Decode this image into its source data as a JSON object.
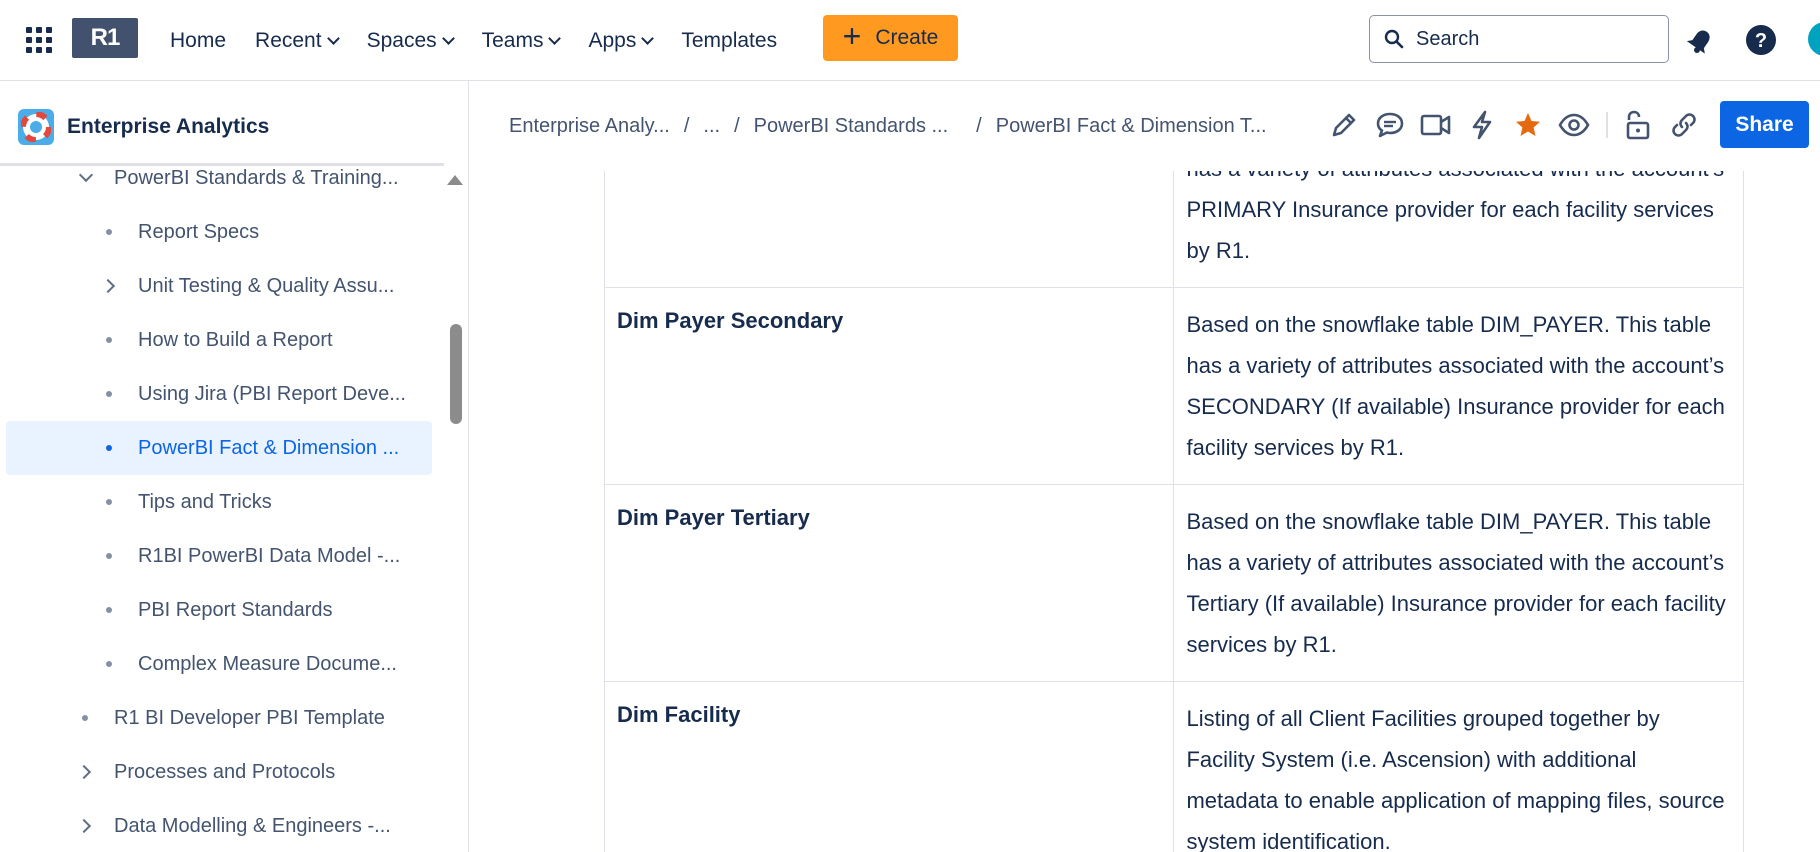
{
  "topbar": {
    "logo_text": "R1",
    "nav": [
      {
        "label": "Home",
        "dropdown": false
      },
      {
        "label": "Recent",
        "dropdown": true
      },
      {
        "label": "Spaces",
        "dropdown": true
      },
      {
        "label": "Teams",
        "dropdown": true
      },
      {
        "label": "Apps",
        "dropdown": true
      },
      {
        "label": "Templates",
        "dropdown": false
      }
    ],
    "create_label": "Create",
    "search_placeholder": "Search",
    "icons": [
      "apps-grid-icon",
      "notifications-icon",
      "help-icon",
      "avatar"
    ]
  },
  "sidebar": {
    "space_title": "Enterprise Analytics",
    "items": [
      {
        "label": "PowerBI Standards & Training...",
        "marker": "chevron-down",
        "level": 0
      },
      {
        "label": "Report Specs",
        "marker": "dot",
        "level": 1
      },
      {
        "label": "Unit Testing & Quality Assu...",
        "marker": "chevron-right",
        "level": 1
      },
      {
        "label": "How to Build a Report",
        "marker": "dot",
        "level": 1
      },
      {
        "label": "Using Jira (PBI Report Deve...",
        "marker": "dot",
        "level": 1
      },
      {
        "label": "PowerBI Fact & Dimension ...",
        "marker": "dot",
        "level": 1,
        "selected": true
      },
      {
        "label": "Tips and Tricks",
        "marker": "dot",
        "level": 1
      },
      {
        "label": "R1BI PowerBI Data Model -...",
        "marker": "dot",
        "level": 1
      },
      {
        "label": "PBI Report Standards",
        "marker": "dot",
        "level": 1
      },
      {
        "label": "Complex Measure Docume...",
        "marker": "dot",
        "level": 1
      },
      {
        "label": "R1 BI Developer PBI Template",
        "marker": "dot",
        "level": 0
      },
      {
        "label": "Processes and Protocols",
        "marker": "chevron-right",
        "level": 0
      },
      {
        "label": "Data Modelling & Engineers -...",
        "marker": "chevron-right",
        "level": 0
      }
    ]
  },
  "page_header": {
    "breadcrumbs": [
      "Enterprise Analy...",
      "...",
      "PowerBI Standards ...",
      "PowerBI Fact & Dimension T..."
    ],
    "separator": "/",
    "action_icons": [
      "edit-icon",
      "comment-icon",
      "video-icon",
      "automation-icon",
      "star-icon",
      "watch-icon",
      "restrictions-icon",
      "link-icon"
    ],
    "share_label": "Share",
    "star_color": "#e56910"
  },
  "table": {
    "rows": [
      {
        "name": "",
        "description": "has a variety of attributes associated with the account’s PRIMARY Insurance provider for each facility services by R1."
      },
      {
        "name": "Dim Payer Secondary",
        "description": "Based on the snowflake table DIM_PAYER. This table has a variety of attributes associated with the account’s SECONDARY (If available) Insurance provider for each facility services by R1."
      },
      {
        "name": "Dim Payer Tertiary",
        "description": "Based on the snowflake table DIM_PAYER. This table has a variety of attributes associated with the account’s Tertiary (If available)  Insurance provider for each facility services by R1."
      },
      {
        "name": "Dim Facility",
        "description": "Listing of all Client Facilities grouped together by Facility System (i.e. Ascension) with additional metadata to enable application of mapping files, source system identification."
      }
    ]
  },
  "colors": {
    "create_button": "#ff991f",
    "share_button": "#0c66e4",
    "selected_item_bg": "#e9f2ff",
    "selected_item_text": "#0c66e4",
    "avatar": "#00a3bf"
  }
}
